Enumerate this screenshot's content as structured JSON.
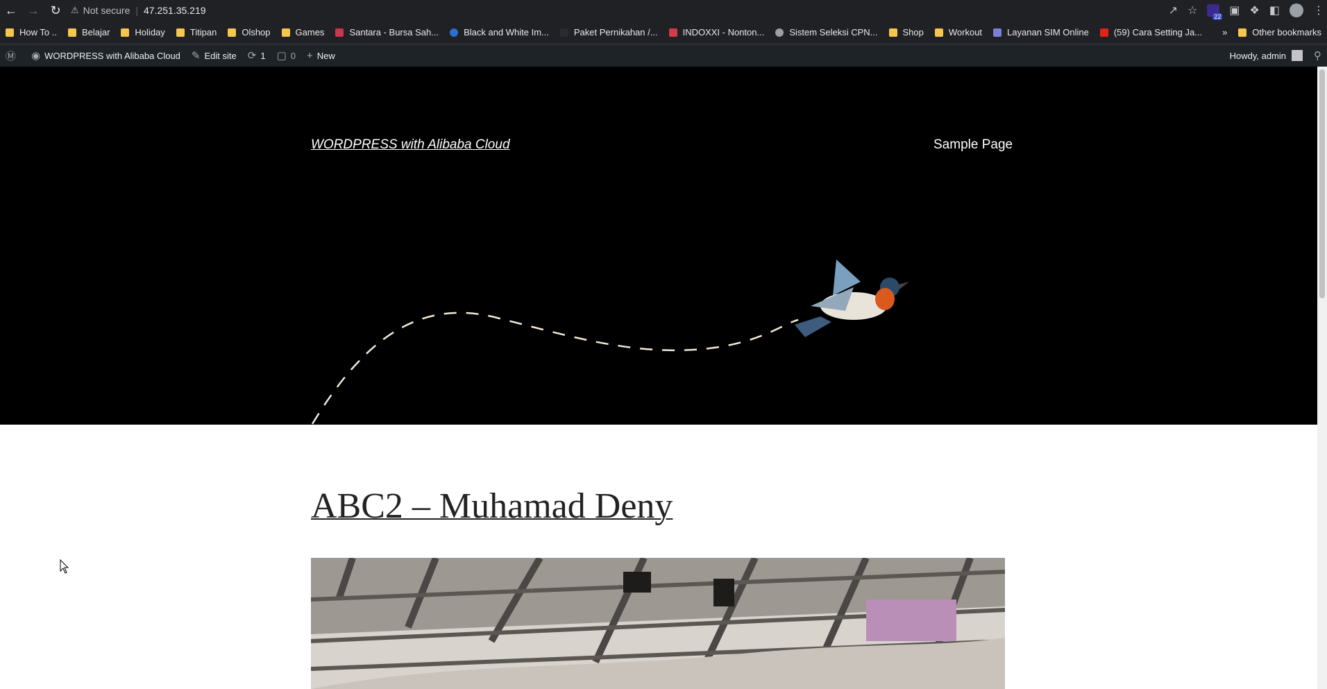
{
  "browser": {
    "security_label": "Not secure",
    "url": "47.251.35.219",
    "extension_badge": "22"
  },
  "bookmarks": [
    {
      "label": "How To ..",
      "icon": "folder-icon"
    },
    {
      "label": "Belajar",
      "icon": "folder-icon"
    },
    {
      "label": "Holiday",
      "icon": "folder-icon"
    },
    {
      "label": "Titipan",
      "icon": "folder-icon"
    },
    {
      "label": "Olshop",
      "icon": "folder-icon"
    },
    {
      "label": "Games",
      "icon": "folder-icon"
    },
    {
      "label": "Santara - Bursa Sah...",
      "icon": "santara-icon"
    },
    {
      "label": "Black and White Im...",
      "icon": "c-logo-icon"
    },
    {
      "label": "Paket Pernikahan /...",
      "icon": "blank-icon"
    },
    {
      "label": "INDOXXI - Nonton...",
      "icon": "indoxxi-icon"
    },
    {
      "label": "Sistem Seleksi CPN...",
      "icon": "globe-icon"
    },
    {
      "label": "Shop",
      "icon": "folder-icon"
    },
    {
      "label": "Workout",
      "icon": "folder-icon"
    },
    {
      "label": "Layanan SIM Online",
      "icon": "police-icon"
    },
    {
      "label": "(59) Cara Setting Ja...",
      "icon": "youtube-icon"
    }
  ],
  "bookmarks_other": "Other bookmarks",
  "admin_bar": {
    "site_name": "WORDPRESS with Alibaba Cloud",
    "edit_site": "Edit site",
    "updates_count": "1",
    "comments_count": "0",
    "new_label": "New",
    "greeting": "Howdy, admin"
  },
  "site": {
    "title": "WORDPRESS with Alibaba Cloud",
    "menu_item": "Sample Page"
  },
  "post": {
    "title": "ABC2 – Muhamad Deny"
  }
}
